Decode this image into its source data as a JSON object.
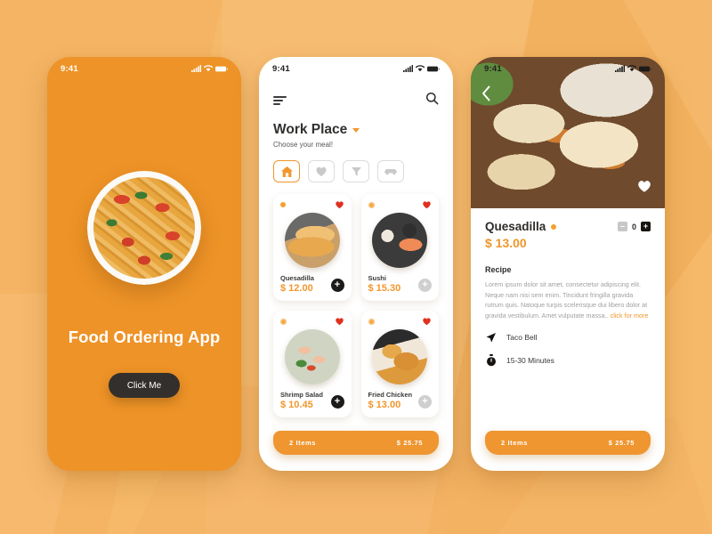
{
  "background": {
    "base_color": "#f5b969",
    "accent_color": "#f0a94f"
  },
  "status_bar": {
    "time": "9:41",
    "icons": [
      "signal-icon",
      "wifi-icon",
      "battery-icon"
    ]
  },
  "splash": {
    "name": "splash-screen",
    "background_color": "#ee9327",
    "title": "Food Ordering App",
    "button_label": "Click Me",
    "hero_image_name": "pasta-bowl-image"
  },
  "list": {
    "name": "menu-list-screen",
    "menu_icon": "hamburger-menu-icon",
    "search_icon": "search-icon",
    "place": "Work Place",
    "place_caret": "chevron-down-icon",
    "subtitle": "Choose your meal!",
    "categories": [
      {
        "icon": "home-icon",
        "active": true
      },
      {
        "icon": "heart-icon",
        "active": false
      },
      {
        "icon": "filter-icon",
        "active": false
      },
      {
        "icon": "car-icon",
        "active": false
      }
    ],
    "cards": [
      {
        "name": "Quesadilla",
        "price": "$ 12.00",
        "thumb": "quesadilla-thumb",
        "add_style": "dark",
        "dot": "solid",
        "favorite": true
      },
      {
        "name": "Sushi",
        "price": "$ 15.30",
        "thumb": "sushi-thumb",
        "add_style": "gray",
        "dot": "ring",
        "favorite": true
      },
      {
        "name": "Shrimp Salad",
        "price": "$ 10.45",
        "thumb": "shrimp-salad-thumb",
        "add_style": "dark",
        "dot": "ring",
        "favorite": true
      },
      {
        "name": "Fried Chicken",
        "price": "$ 13.00",
        "thumb": "fried-chicken-thumb",
        "add_style": "gray",
        "dot": "ring",
        "favorite": true
      }
    ],
    "cart": {
      "items_label": "2 Items",
      "total": "$ 25.75"
    }
  },
  "detail": {
    "name": "product-detail-screen",
    "back_icon": "back-chevron-icon",
    "favorite_icon": "heart-icon",
    "hero_image_name": "quesadilla-hero-image",
    "title": "Quesadilla",
    "title_dot": "orange-dot",
    "quantity": "0",
    "minus_label": "–",
    "plus_label": "+",
    "price": "$ 13.00",
    "recipe_heading": "Recipe",
    "recipe_text": "Lorem ipsum dolor sit amet, consectetur adipiscing elit. Neque nam nisi sem enim. Tincidunt fringilla gravida rutrum quis. Natoque turpis scelerisque dui libero dolor at gravida vestibulum. Amet vulputate massa.. ",
    "recipe_more": "click for more",
    "restaurant": "Taco Bell",
    "restaurant_icon": "navigation-arrow-icon",
    "delivery_time": "15-30 Minutes",
    "time_icon": "stopwatch-icon",
    "cart": {
      "items_label": "2 Items",
      "total": "$ 25.75"
    }
  }
}
